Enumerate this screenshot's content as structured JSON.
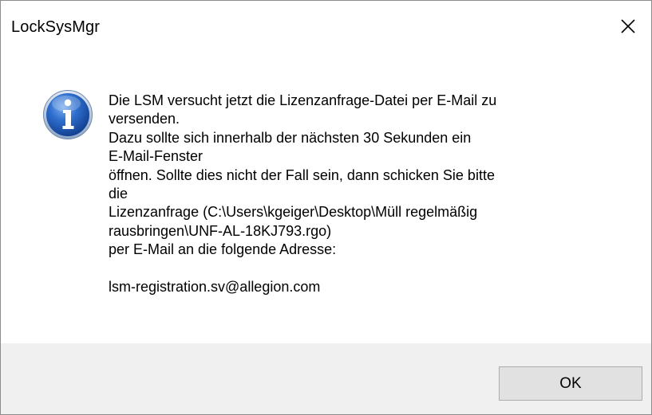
{
  "window": {
    "title": "LockSysMgr",
    "close_icon": "close-icon",
    "close_symbol": "✕"
  },
  "message": {
    "icon": "info-icon",
    "lines": [
      "Die LSM versucht jetzt die Lizenzanfrage-Datei per E-Mail zu",
      "versenden.",
      "Dazu sollte sich innerhalb der nächsten 30 Sekunden ein",
      "E-Mail-Fenster",
      "öffnen. Sollte dies nicht der Fall sein, dann schicken Sie bitte",
      "die",
      "Lizenzanfrage (C:\\Users\\kgeiger\\Desktop\\Müll regelmäßig",
      "rausbringen\\UNF-AL-18KJ793.rgo)",
      "per E-Mail an die folgende Adresse:"
    ],
    "email": "lsm-registration.sv@allegion.com"
  },
  "footer": {
    "ok_label": "OK"
  },
  "colors": {
    "icon_blue": "#1e5bb8",
    "footer_bg": "#f0f0f0",
    "button_bg": "#e1e1e1"
  }
}
